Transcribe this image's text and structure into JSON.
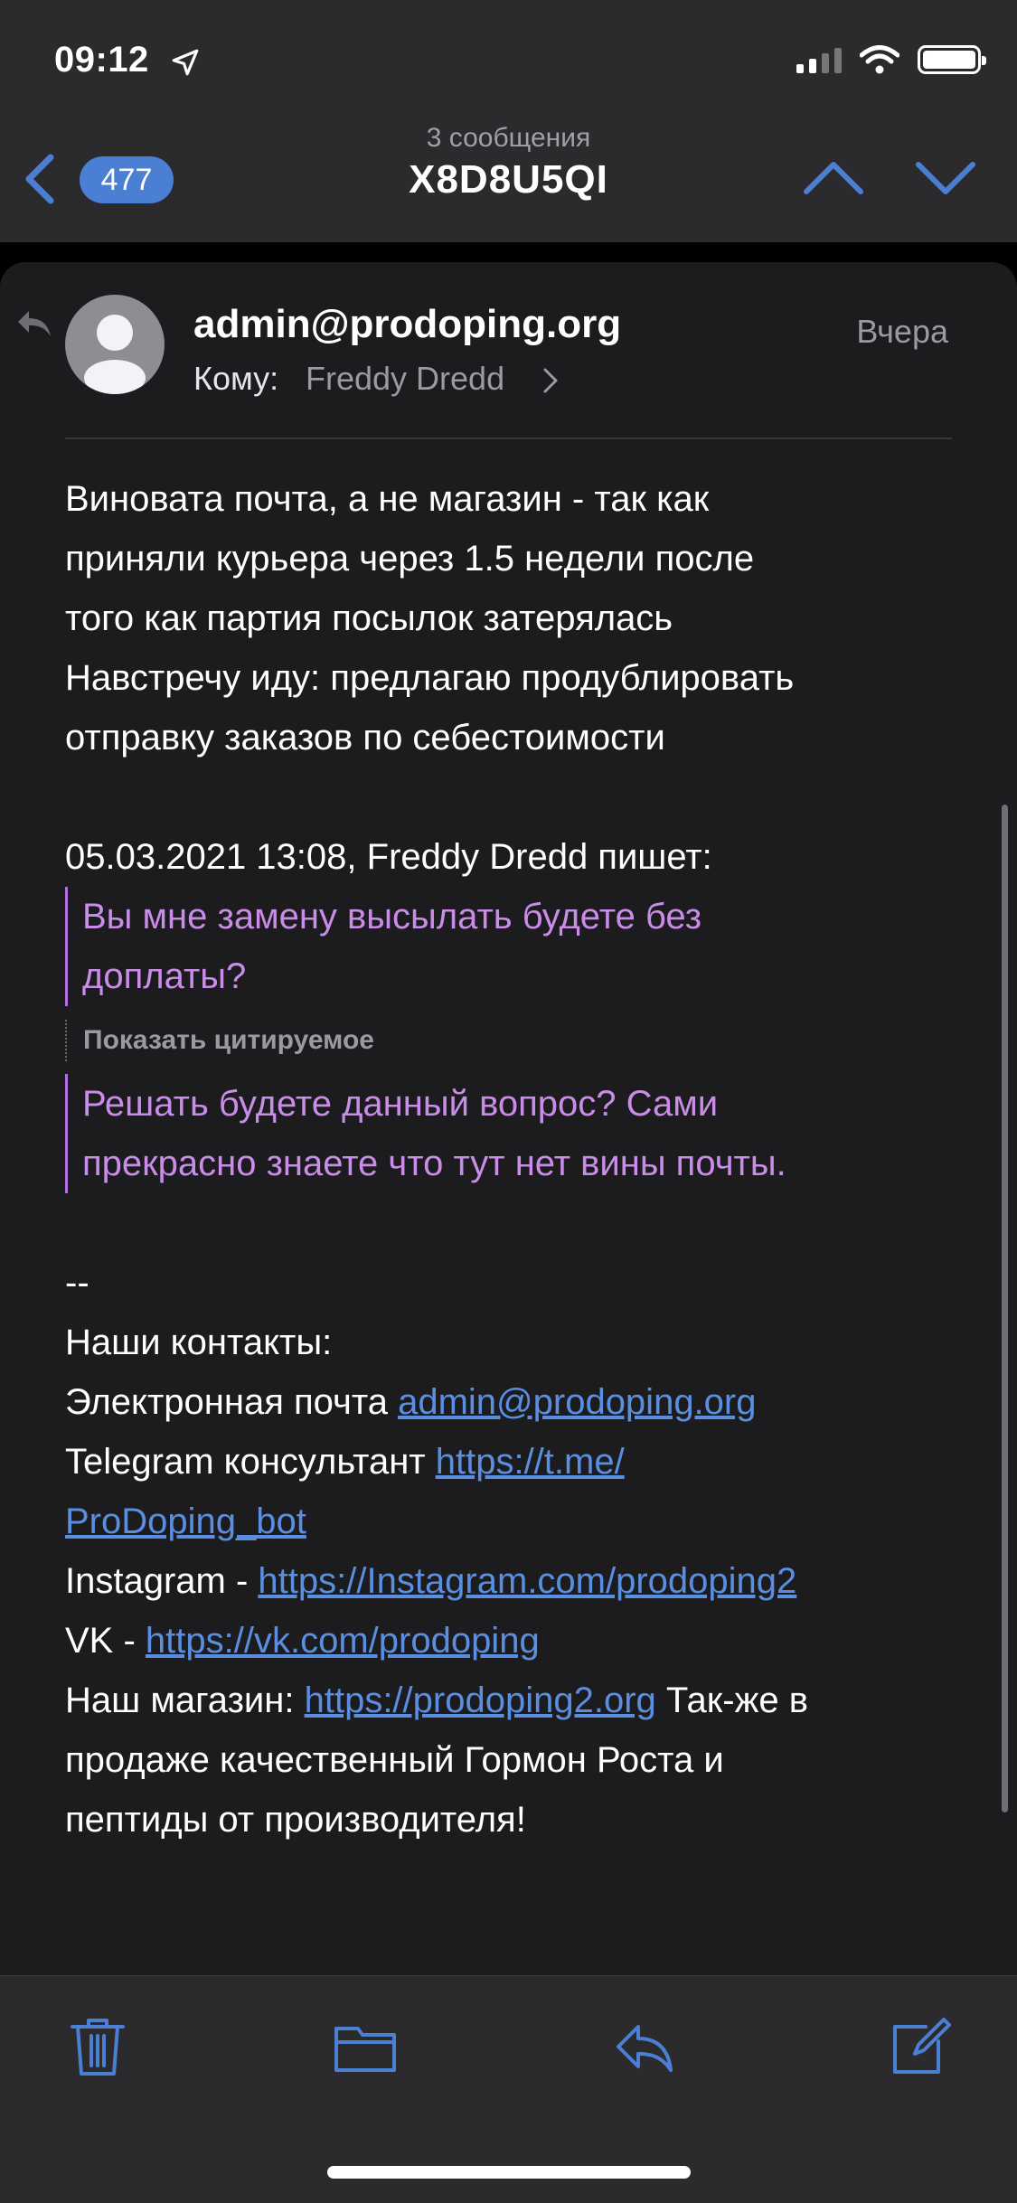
{
  "status_bar": {
    "time": "09:12"
  },
  "nav": {
    "unread_count": "477",
    "subtitle": "3 сообщения",
    "title": "X8D8U5QI"
  },
  "message": {
    "sender": "admin@prodoping.org",
    "date": "Вчера",
    "to_label": "Кому:",
    "to_name": "Freddy Dredd",
    "body_lines": [
      "Виновата почта, а не магазин - так как",
      "приняли курьера через 1.5 недели после",
      "того как партия посылок затерялась",
      "Навстречу иду: предлагаю продублировать",
      "отправку заказов по себестоимости"
    ],
    "quote_header": "05.03.2021 13:08, Freddy Dredd пишет:",
    "quote1_lines": [
      "Вы мне замену высылать будете без",
      "доплаты?"
    ],
    "show_quoted": "Показать цитируемое",
    "quote2_lines": [
      "Решать будете данный вопрос? Сами",
      "прекрасно знаете что тут нет вины почты."
    ],
    "signature": {
      "separator": "--",
      "contacts_label": "Наши контакты:",
      "email_label": "Электронная почта ",
      "email_link": "admin@prodoping.org",
      "telegram_label": "Telegram консультант ",
      "telegram_link_part1": "https://t.me/",
      "telegram_link_part2": "ProDoping_bot",
      "instagram_label": "Instagram - ",
      "instagram_link": "https://Instagram.com/prodoping2",
      "vk_label": "VK - ",
      "vk_link": "https://vk.com/prodoping",
      "shop_label": "Наш магазин: ",
      "shop_link": "https://prodoping2.org",
      "shop_after": " Так-же в",
      "promo_line2": "продаже качественный Гормон Роста и",
      "promo_line3": "пептиды от производителя!"
    }
  },
  "toolbar": {
    "icons": [
      "trash-icon",
      "folder-icon",
      "reply-icon",
      "compose-icon"
    ]
  },
  "colors": {
    "accent": "#4a7fd4",
    "link": "#5a8ee0",
    "quote": "#c98ce8",
    "quote_bar": "#b46fe3",
    "card_bg": "#1c1c1e",
    "bar_bg": "#2b2b2d"
  }
}
